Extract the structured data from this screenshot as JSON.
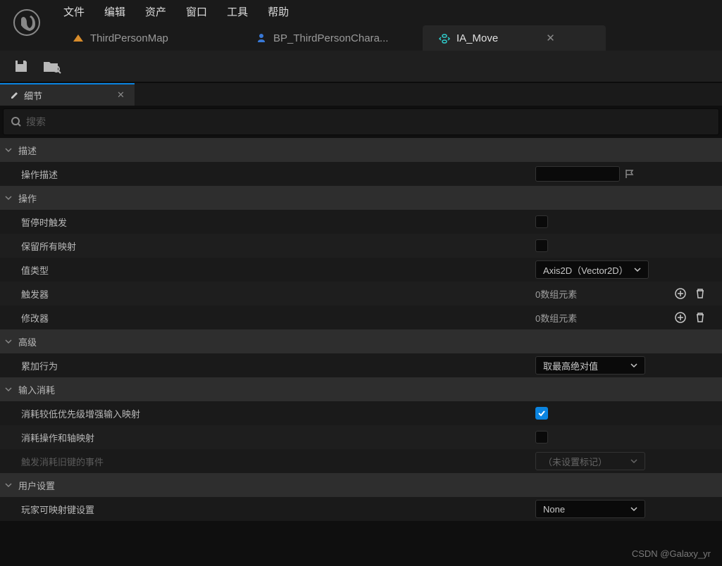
{
  "menubar": {
    "items": [
      "文件",
      "编辑",
      "资产",
      "窗口",
      "工具",
      "帮助"
    ]
  },
  "tabs": [
    {
      "label": "ThirdPersonMap",
      "icon": "level-icon",
      "active": false
    },
    {
      "label": "BP_ThirdPersonChara...",
      "icon": "blueprint-icon",
      "active": false
    },
    {
      "label": "IA_Move",
      "icon": "input-action-icon",
      "active": true
    }
  ],
  "panel": {
    "title": "细节"
  },
  "search": {
    "placeholder": "搜索"
  },
  "sections": {
    "description": {
      "title": "描述",
      "rows": {
        "action_description": {
          "label": "操作描述",
          "value": ""
        }
      }
    },
    "action": {
      "title": "操作",
      "rows": {
        "trigger_when_paused": {
          "label": "暂停时触发",
          "checked": false
        },
        "reserve_all_mappings": {
          "label": "保留所有映射",
          "checked": false
        },
        "value_type": {
          "label": "值类型",
          "value": "Axis2D（Vector2D）"
        },
        "triggers": {
          "label": "触发器",
          "count": "0数组元素"
        },
        "modifiers": {
          "label": "修改器",
          "count": "0数组元素"
        }
      }
    },
    "advanced": {
      "title": "高级",
      "rows": {
        "accumulation_behavior": {
          "label": "累加行为",
          "value": "取最高绝对值"
        }
      }
    },
    "input_consumption": {
      "title": "输入消耗",
      "rows": {
        "consume_lower": {
          "label": "消耗较低优先级增强输入映射",
          "checked": true
        },
        "consume_axis": {
          "label": "消耗操作和轴映射",
          "checked": false
        },
        "trigger_consumed_events": {
          "label": "触发消耗旧键的事件",
          "value": "（未设置标记）",
          "disabled": true
        }
      }
    },
    "user_settings": {
      "title": "用户设置",
      "rows": {
        "player_mappable": {
          "label": "玩家可映射键设置",
          "value": "None"
        }
      }
    }
  },
  "watermark": "CSDN @Galaxy_yr"
}
